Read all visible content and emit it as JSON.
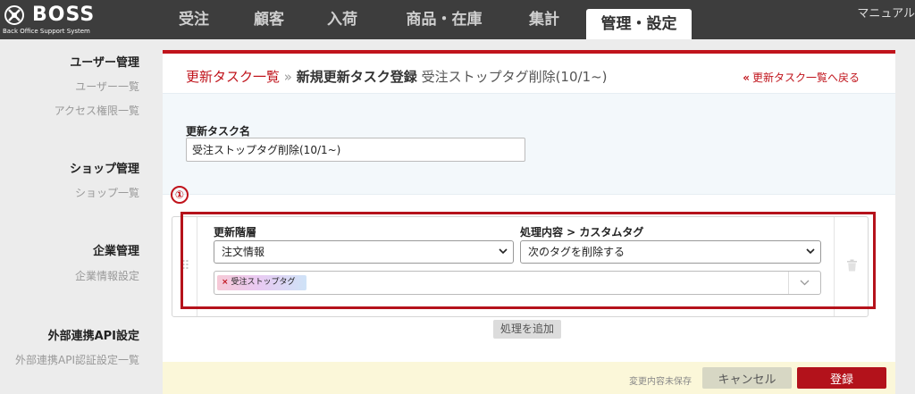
{
  "header": {
    "logo_text": "BOSS",
    "logo_subtitle": "Back Office Support System",
    "nav": [
      {
        "label": "受注"
      },
      {
        "label": "顧客"
      },
      {
        "label": "入荷"
      },
      {
        "label": "商品・在庫"
      },
      {
        "label": "集計"
      },
      {
        "label": "管理・設定",
        "active": true
      }
    ],
    "manual_link": "マニュアル"
  },
  "sidebar": {
    "groups": [
      {
        "title": "ユーザー管理",
        "items": [
          "ユーザー一覧",
          "アクセス権限一覧"
        ]
      },
      {
        "title": "ショップ管理",
        "items": [
          "ショップ一覧"
        ]
      },
      {
        "title": "企業管理",
        "items": [
          "企業情報設定"
        ]
      },
      {
        "title": "外部連携API設定",
        "items": [
          "外部連携API認証設定一覧"
        ]
      }
    ]
  },
  "breadcrumb": {
    "link": "更新タスク一覧",
    "separator": "»",
    "section": "新規更新タスク登録",
    "current": "受注ストップタグ削除(10/1~)"
  },
  "back_link": "更新タスク一覧へ戻る",
  "form": {
    "task_name_label": "更新タスク名",
    "task_name_value": "受注ストップタグ削除(10/1~)"
  },
  "annotation_marker": "①",
  "process": {
    "level_label": "更新階層",
    "level_value": "注文情報",
    "action_label": "処理内容 > カスタムタグ",
    "action_value": "次のタグを削除する",
    "tag": "受注ストップタグ"
  },
  "add_process_label": "処理を追加",
  "footer": {
    "unsaved": "変更内容未保存",
    "cancel": "キャンセル",
    "register": "登録"
  },
  "colors": {
    "brand_red": "#c0141c",
    "header_bg": "#3d3d3d"
  }
}
